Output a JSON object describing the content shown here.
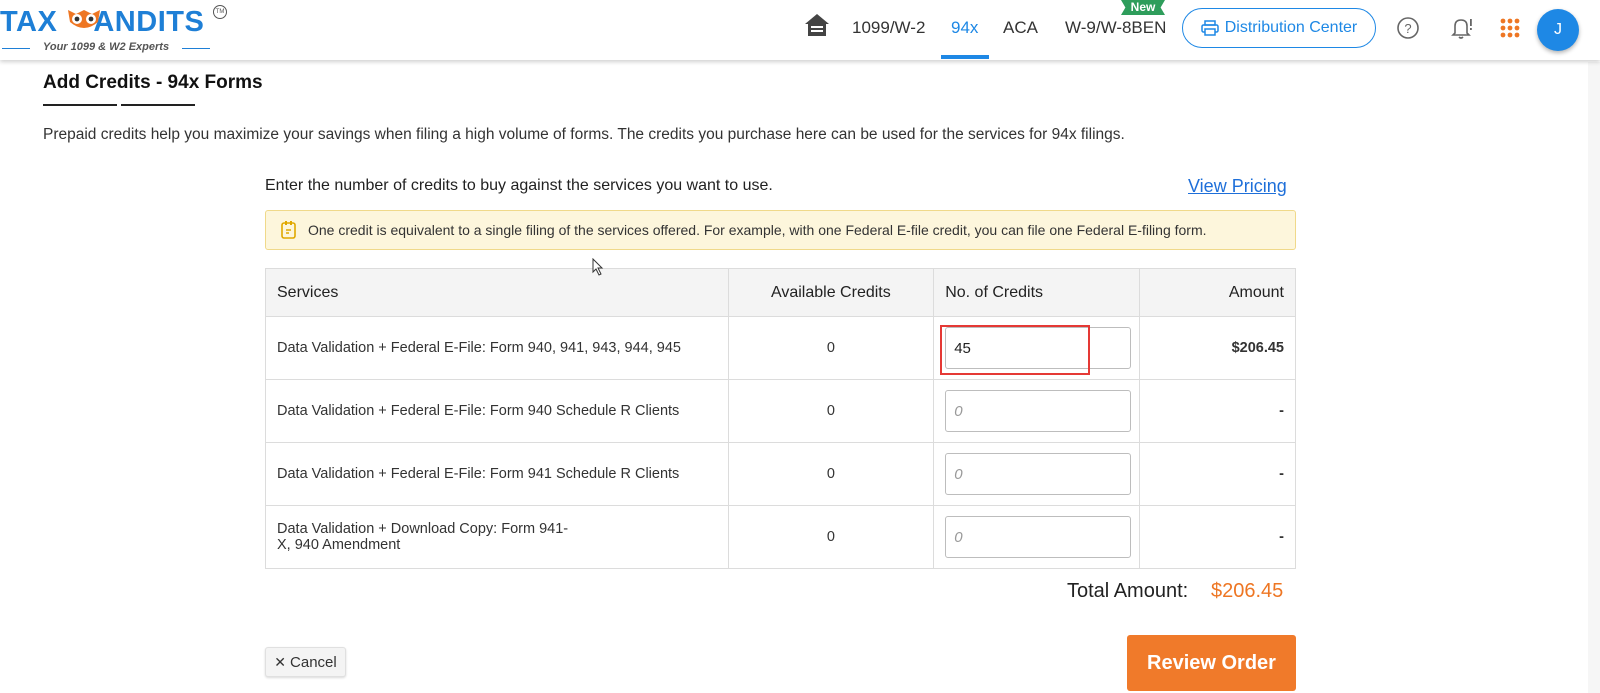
{
  "logo": {
    "text": "TAXBANDITS",
    "tagline": "Your 1099 & W2 Experts",
    "tm": "TM"
  },
  "nav": {
    "items": [
      {
        "label": "1099/W-2"
      },
      {
        "label": "94x"
      },
      {
        "label": "ACA"
      },
      {
        "label": "W-9/W-8BEN"
      }
    ],
    "active": "94x",
    "new_badge": "New",
    "distribution_center": "Distribution Center",
    "avatar_initial": "J"
  },
  "page": {
    "title": "Add Credits - 94x Forms",
    "intro": "Prepaid credits help you maximize your savings when filing a high volume of forms. The credits you purchase here can be used for the services for 94x filings.",
    "enter_text": "Enter the number of credits to buy against the services you want to use.",
    "view_pricing": "View Pricing",
    "info": "One credit is equivalent to a single filing of the services offered. For example, with one Federal E-file credit, you can file one Federal E-filing form."
  },
  "table": {
    "headers": [
      "Services",
      "Available Credits",
      "No. of Credits",
      "Amount"
    ],
    "rows": [
      {
        "service": "Data Validation + Federal E-File: Form 940, 941, 943, 944, 945",
        "available": "0",
        "credits": "45",
        "placeholder": "0",
        "amount": "$206.45"
      },
      {
        "service": "Data Validation + Federal E-File: Form 940 Schedule R Clients",
        "available": "0",
        "credits": "",
        "placeholder": "0",
        "amount": "-"
      },
      {
        "service": "Data Validation + Federal E-File: Form 941 Schedule R Clients",
        "available": "0",
        "credits": "",
        "placeholder": "0",
        "amount": "-"
      },
      {
        "service": "Data Validation + Download Copy: Form 941-X, 940 Amendment",
        "available": "0",
        "credits": "",
        "placeholder": "0",
        "amount": "-"
      }
    ]
  },
  "total": {
    "label": "Total Amount:",
    "value": "$206.45"
  },
  "buttons": {
    "cancel": "Cancel",
    "review": "Review Order"
  },
  "colors": {
    "brand_blue": "#1e88e5",
    "orange": "#f07a2a",
    "info_bg": "#fdf6dc"
  }
}
